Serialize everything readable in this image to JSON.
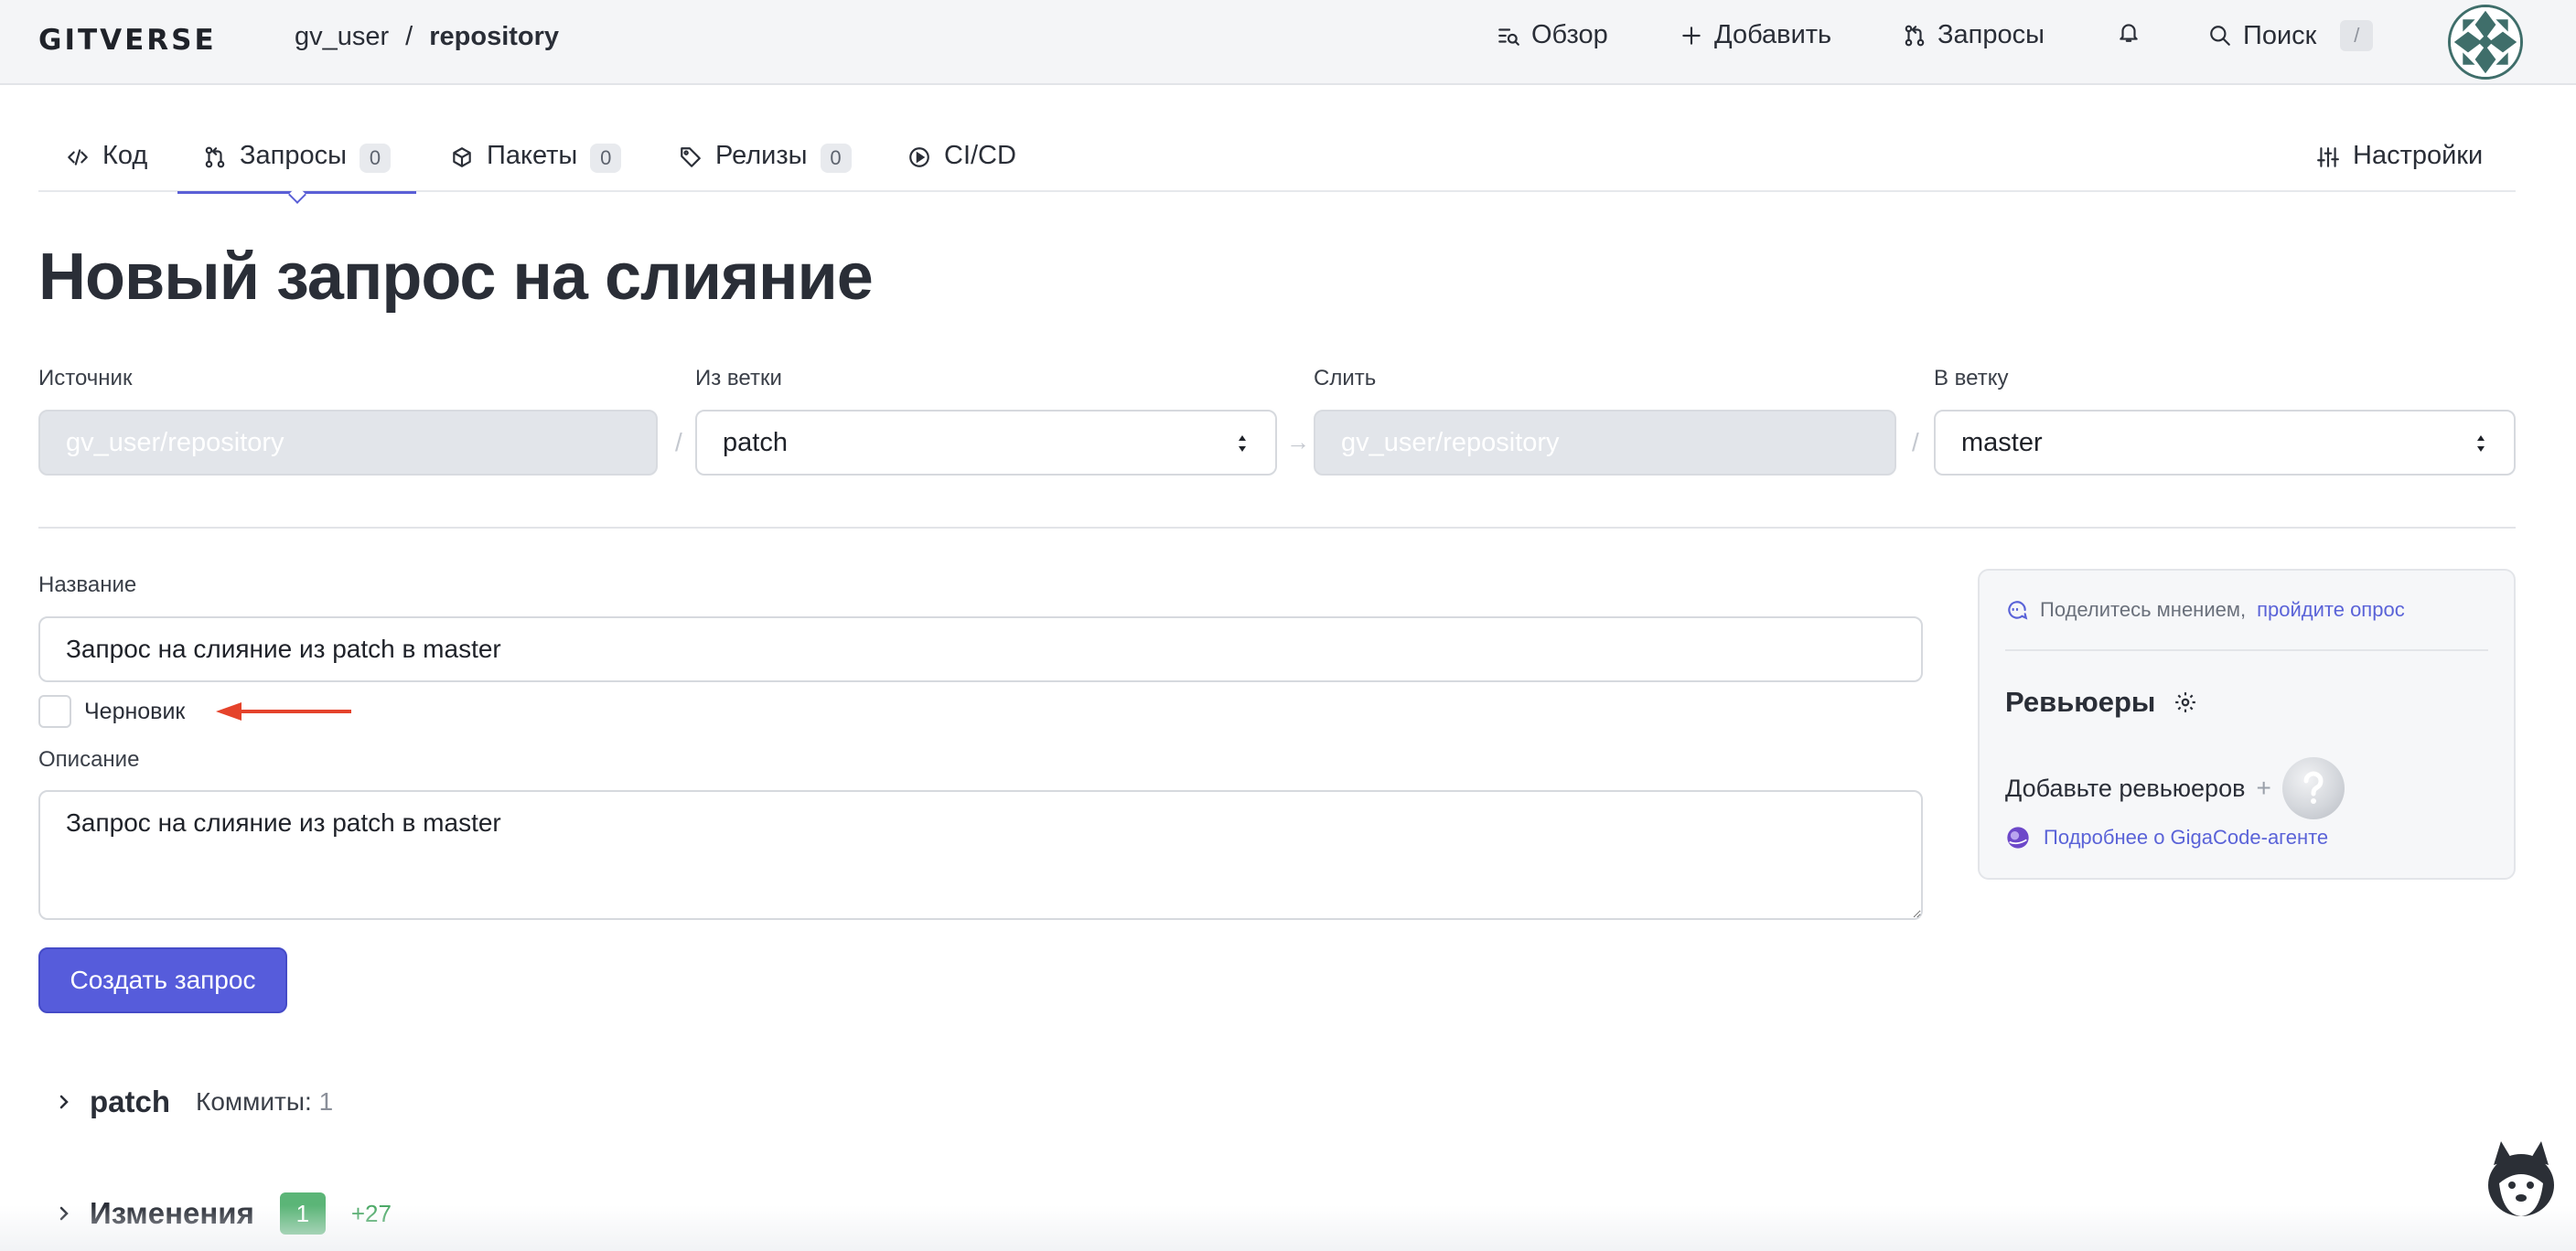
{
  "header": {
    "logo": "GITVERSE",
    "breadcrumb": {
      "user": "gv_user",
      "separator": "/",
      "repo": "repository"
    },
    "nav": {
      "overview": "Обзор",
      "add": "Добавить",
      "requests": "Запросы",
      "search": "Поиск",
      "search_shortcut": "/"
    }
  },
  "tabs": [
    {
      "label": "Код",
      "icon": "code-icon"
    },
    {
      "label": "Запросы",
      "count": "0",
      "icon": "pull-request-icon",
      "active": true
    },
    {
      "label": "Пакеты",
      "count": "0",
      "icon": "package-icon"
    },
    {
      "label": "Релизы",
      "count": "0",
      "icon": "tag-icon"
    },
    {
      "label": "CI/CD",
      "icon": "play-circle-icon"
    }
  ],
  "settings_label": "Настройки",
  "page_title": "Новый запрос на слияние",
  "branches": {
    "source_label": "Источник",
    "source_value": "gv_user/repository",
    "from_branch_label": "Из ветки",
    "from_branch_value": "patch",
    "merge_label": "Слить",
    "merge_value": "gv_user/repository",
    "to_branch_label": "В ветку",
    "to_branch_value": "master",
    "separator": "/"
  },
  "form": {
    "title_label": "Название",
    "title_value": "Запрос на слияние из patch в master",
    "draft_label": "Черновик",
    "draft_checked": false,
    "description_label": "Описание",
    "description_value": "Запрос на слияние из patch в master",
    "submit_label": "Создать запрос"
  },
  "sidebar": {
    "survey_text": "Поделитесь мнением,",
    "survey_link": "пройдите опрос",
    "reviewers_title": "Ревьюеры",
    "add_reviewers": "Добавьте ревьюеров",
    "add_plus": "+",
    "gigacode_link": "Подробнее о GigaCode-агенте"
  },
  "commits_section": {
    "branch": "patch",
    "label": "Коммиты:",
    "count": "1"
  },
  "changes_section": {
    "label": "Изменения",
    "files": "1",
    "additions": "+27"
  },
  "colors": {
    "accent": "#565cdb",
    "link": "#5a63d8",
    "additions": "#4aa865",
    "annotation_arrow": "#e5432b"
  }
}
